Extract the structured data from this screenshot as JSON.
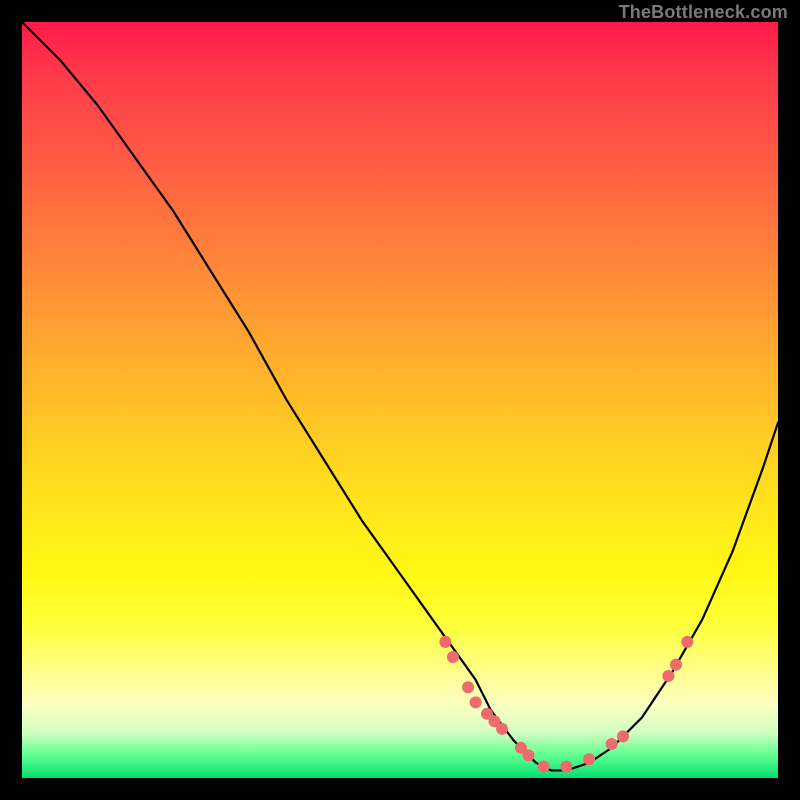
{
  "watermark": "TheBottleneck.com",
  "chart_data": {
    "type": "line",
    "title": "",
    "xlabel": "",
    "ylabel": "",
    "x_range": [
      0,
      100
    ],
    "y_range": [
      0,
      100
    ],
    "curve": {
      "x": [
        0,
        5,
        10,
        15,
        20,
        25,
        30,
        35,
        40,
        45,
        50,
        55,
        60,
        62,
        65,
        68,
        70,
        72,
        75,
        78,
        82,
        86,
        90,
        94,
        98,
        100
      ],
      "y": [
        100,
        95,
        89,
        82,
        75,
        67,
        59,
        50,
        42,
        34,
        27,
        20,
        13,
        9,
        5,
        2,
        1,
        1,
        2,
        4,
        8,
        14,
        21,
        30,
        41,
        47
      ]
    },
    "markers": {
      "x": [
        56,
        57,
        59,
        60,
        61.5,
        62.5,
        63.5,
        66,
        67,
        69,
        72,
        75,
        78,
        79.5,
        85.5,
        86.5,
        88
      ],
      "y": [
        18,
        16,
        12,
        10,
        8.5,
        7.5,
        6.5,
        4,
        3,
        1.5,
        1.5,
        2.5,
        4.5,
        5.5,
        13.5,
        15,
        18
      ]
    },
    "marker_color": "#ee6b6b",
    "curve_color": "#000000",
    "gradient_stops": [
      {
        "pos": 0,
        "color": "#ff1a4a"
      },
      {
        "pos": 50,
        "color": "#ffb82a"
      },
      {
        "pos": 80,
        "color": "#ffff33"
      },
      {
        "pos": 100,
        "color": "#00e070"
      }
    ]
  }
}
